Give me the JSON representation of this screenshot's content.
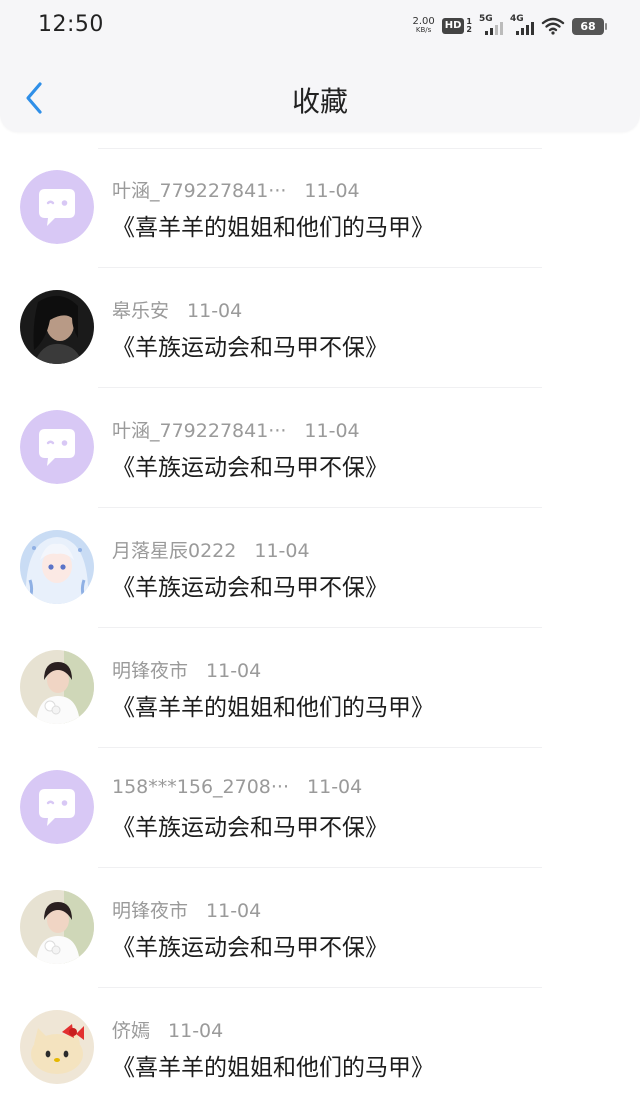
{
  "status_bar": {
    "time": "12:50",
    "net_speed_value": "2.00",
    "net_speed_unit": "KB/s",
    "hd_label": "HD",
    "hd_sub_1": "1",
    "hd_sub_2": "2",
    "sig1_label": "5G",
    "sig2_label": "4G",
    "battery": "68"
  },
  "header": {
    "title": "收藏",
    "back_icon": "chevron-left-icon",
    "accent_color": "#2f8fe8"
  },
  "items": [
    {
      "user": "叶涵_779227841···",
      "date": "11-04",
      "title": "《喜羊羊的姐姐和他们的马甲》",
      "avatar": "default"
    },
    {
      "user": "皋乐安",
      "date": "11-04",
      "title": "《羊族运动会和马甲不保》",
      "avatar": "dark-photo"
    },
    {
      "user": "叶涵_779227841···",
      "date": "11-04",
      "title": "《羊族运动会和马甲不保》",
      "avatar": "default"
    },
    {
      "user": "月落星辰0222",
      "date": "11-04",
      "title": "《羊族运动会和马甲不保》",
      "avatar": "anime"
    },
    {
      "user": "明锋夜市",
      "date": "11-04",
      "title": "《喜羊羊的姐姐和他们的马甲》",
      "avatar": "bride"
    },
    {
      "user": "158***156_2708···",
      "date": "11-04",
      "title": "《羊族运动会和马甲不保》",
      "avatar": "default"
    },
    {
      "user": "明锋夜市",
      "date": "11-04",
      "title": "《羊族运动会和马甲不保》",
      "avatar": "bride"
    },
    {
      "user": "侪嫣",
      "date": "11-04",
      "title": "《喜羊羊的姐姐和他们的马甲》",
      "avatar": "kitty"
    }
  ]
}
